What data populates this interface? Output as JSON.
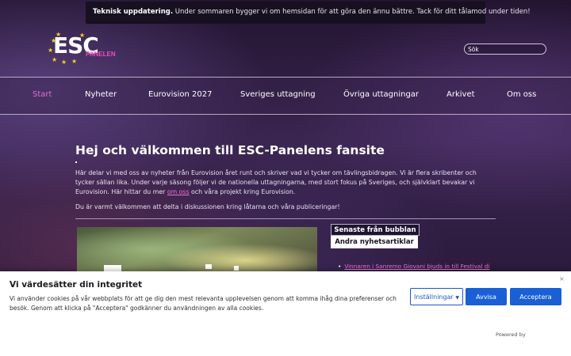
{
  "notice": {
    "bold": "Teknisk uppdatering.",
    "text": " Under sommaren bygger vi om hemsidan för att göra den ännu bättre. Tack för ditt tålamod under tiden!"
  },
  "logo": {
    "main": "ESC",
    "sub": "PANELEN"
  },
  "search": {
    "placeholder": "Sök"
  },
  "nav": {
    "items": [
      "Start",
      "Nyheter",
      "Eurovision 2027",
      "Sveriges uttagning",
      "Övriga uttagningar",
      "Arkivet",
      "Om oss"
    ],
    "active": "Start"
  },
  "main": {
    "title": "Hej och välkommen till ESC-Panelens fansite",
    "intro_before": "Här delar vi med oss av nyheter från Eurovision året runt och skriver vad vi tycker om tävlingsbidragen. Vi är flera skribenter och tycker sällan lika. Under varje säsong följer vi de nationella uttagningarna, med stort fokus på Sveriges, och självklart bevakar vi Eurovision. Här hittar du mer ",
    "intro_link": "om oss",
    "intro_after": " och våra projekt kring Eurovision.",
    "intro2": "Du är varmt välkommen att delta i diskussionen kring låtarna och våra publiceringar!"
  },
  "tabs": {
    "latest": "Senaste från bubblan",
    "other": "Andra nyhetsartiklar"
  },
  "news": [
    "Vinnaren i Sanremo Giovani bjuds in till Festival di"
  ],
  "cookie": {
    "title": "Vi värdesätter din integritet",
    "text": "Vi använder cookies på vår webbplats för att ge dig den mest relevanta upplevelsen genom att komma ihåg dina preferenser och besök. Genom att klicka på \"Acceptera\" godkänner du användningen av alla cookies.",
    "settings": "Inställningar",
    "reject": "Avvisa",
    "accept": "Acceptera",
    "close": "×",
    "powered": "Powered by"
  },
  "colors": {
    "accent": "#e56ad0",
    "button_blue": "#1a5fd6"
  }
}
